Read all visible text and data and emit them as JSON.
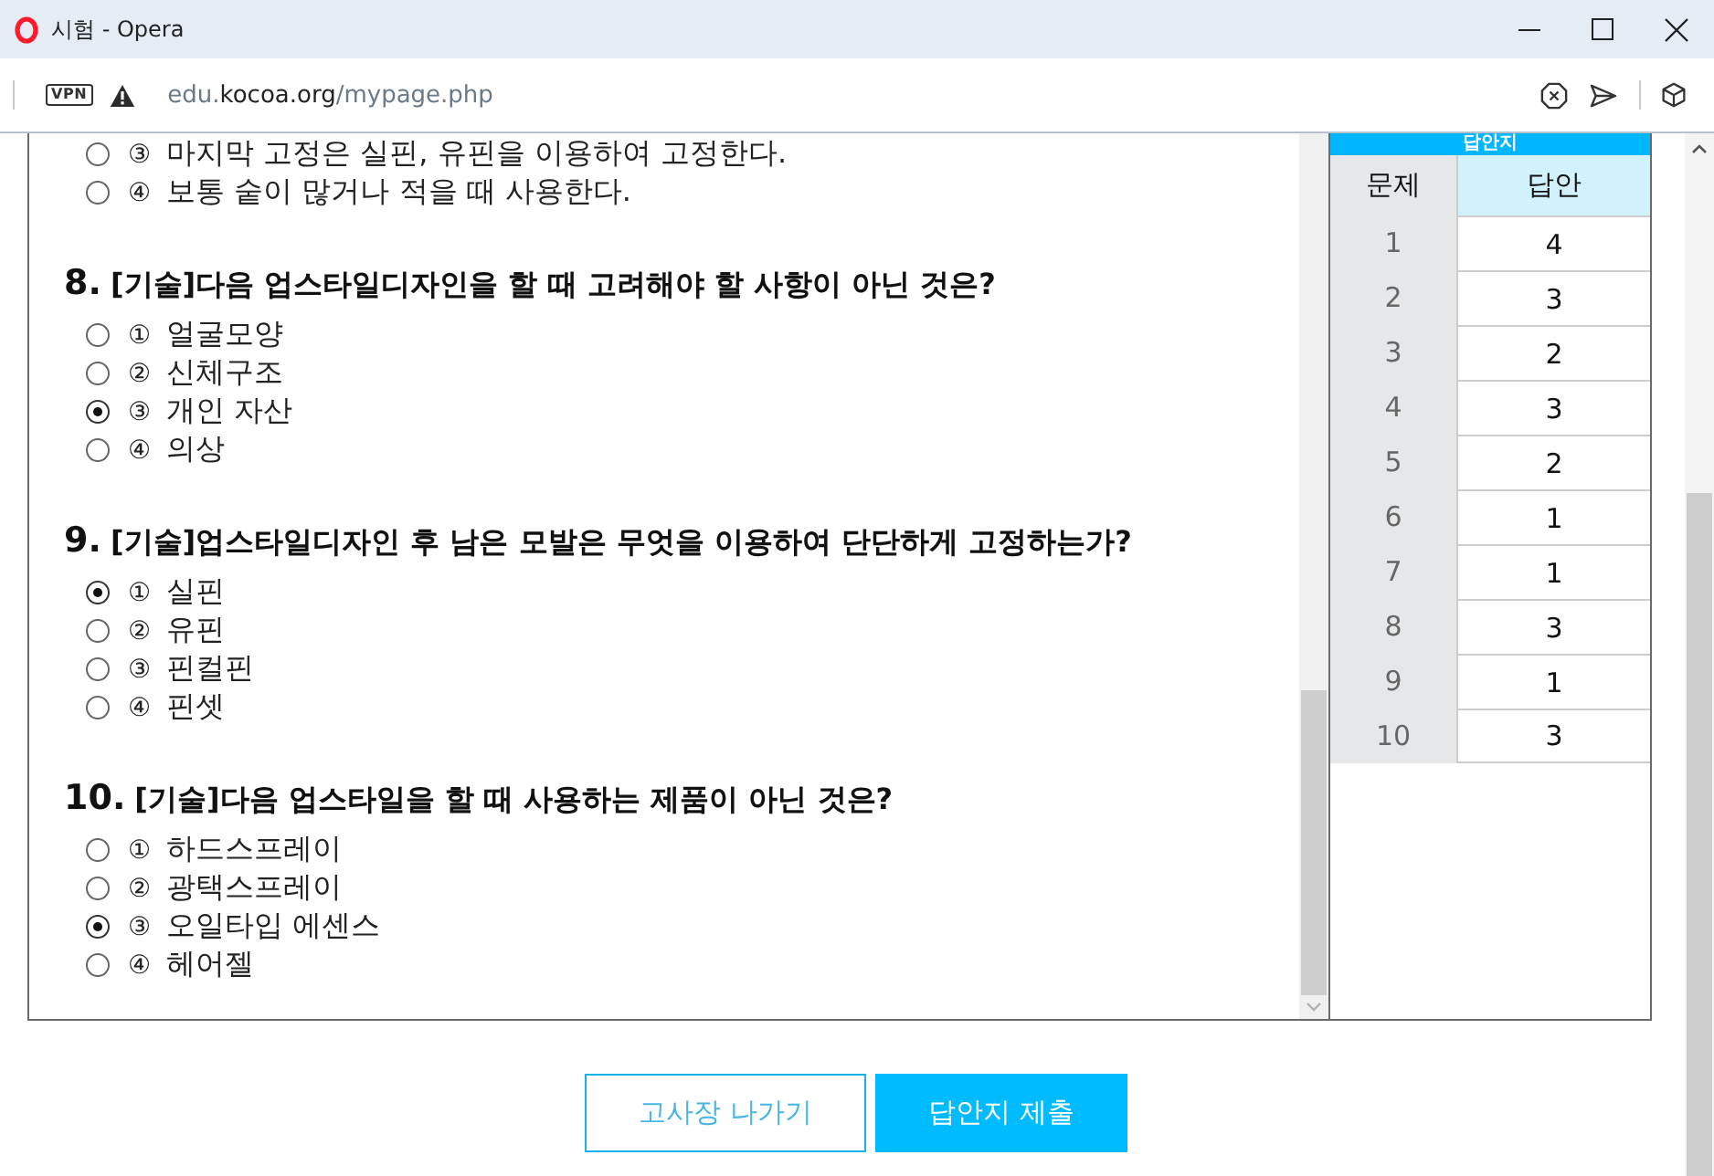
{
  "window": {
    "title": "시험 - Opera"
  },
  "address_bar": {
    "vpn": "VPN",
    "url": {
      "prefix": "edu.",
      "domain": "kocoa.org",
      "path": "/mypage.php"
    }
  },
  "questions": [
    {
      "options": [
        {
          "marker": "③",
          "text": "마지막 고정은 실핀, 유핀을 이용하여 고정한다.",
          "selected": false
        },
        {
          "marker": "④",
          "text": "보통 숱이 많거나 적을 때 사용한다.",
          "selected": false
        }
      ]
    },
    {
      "number": "8.",
      "text": "[기술]다음 업스타일디자인을 할 때 고려해야 할 사항이 아닌 것은?",
      "options": [
        {
          "marker": "①",
          "text": "얼굴모양",
          "selected": false
        },
        {
          "marker": "②",
          "text": "신체구조",
          "selected": false
        },
        {
          "marker": "③",
          "text": "개인 자산",
          "selected": true
        },
        {
          "marker": "④",
          "text": "의상",
          "selected": false
        }
      ]
    },
    {
      "number": "9.",
      "text": "[기술]업스타일디자인 후 남은 모발은 무엇을 이용하여 단단하게 고정하는가?",
      "options": [
        {
          "marker": "①",
          "text": "실핀",
          "selected": true
        },
        {
          "marker": "②",
          "text": "유핀",
          "selected": false
        },
        {
          "marker": "③",
          "text": "핀컬핀",
          "selected": false
        },
        {
          "marker": "④",
          "text": "핀셋",
          "selected": false
        }
      ]
    },
    {
      "number": "10.",
      "text": "[기술]다음 업스타일을 할 때 사용하는 제품이 아닌 것은?",
      "options": [
        {
          "marker": "①",
          "text": "하드스프레이",
          "selected": false
        },
        {
          "marker": "②",
          "text": "광택스프레이",
          "selected": false
        },
        {
          "marker": "③",
          "text": "오일타입 에센스",
          "selected": true
        },
        {
          "marker": "④",
          "text": "헤어젤",
          "selected": false
        }
      ]
    }
  ],
  "answer_sheet": {
    "title": "답안지",
    "columns": [
      "문제",
      "답안"
    ],
    "rows": [
      [
        "1",
        "4"
      ],
      [
        "2",
        "3"
      ],
      [
        "3",
        "2"
      ],
      [
        "4",
        "3"
      ],
      [
        "5",
        "2"
      ],
      [
        "6",
        "1"
      ],
      [
        "7",
        "1"
      ],
      [
        "8",
        "3"
      ],
      [
        "9",
        "1"
      ],
      [
        "10",
        "3"
      ]
    ]
  },
  "buttons": [
    {
      "label": "고사장 나가기",
      "kind": "outline"
    },
    {
      "label": "답안지 제출",
      "kind": "primary"
    }
  ]
}
